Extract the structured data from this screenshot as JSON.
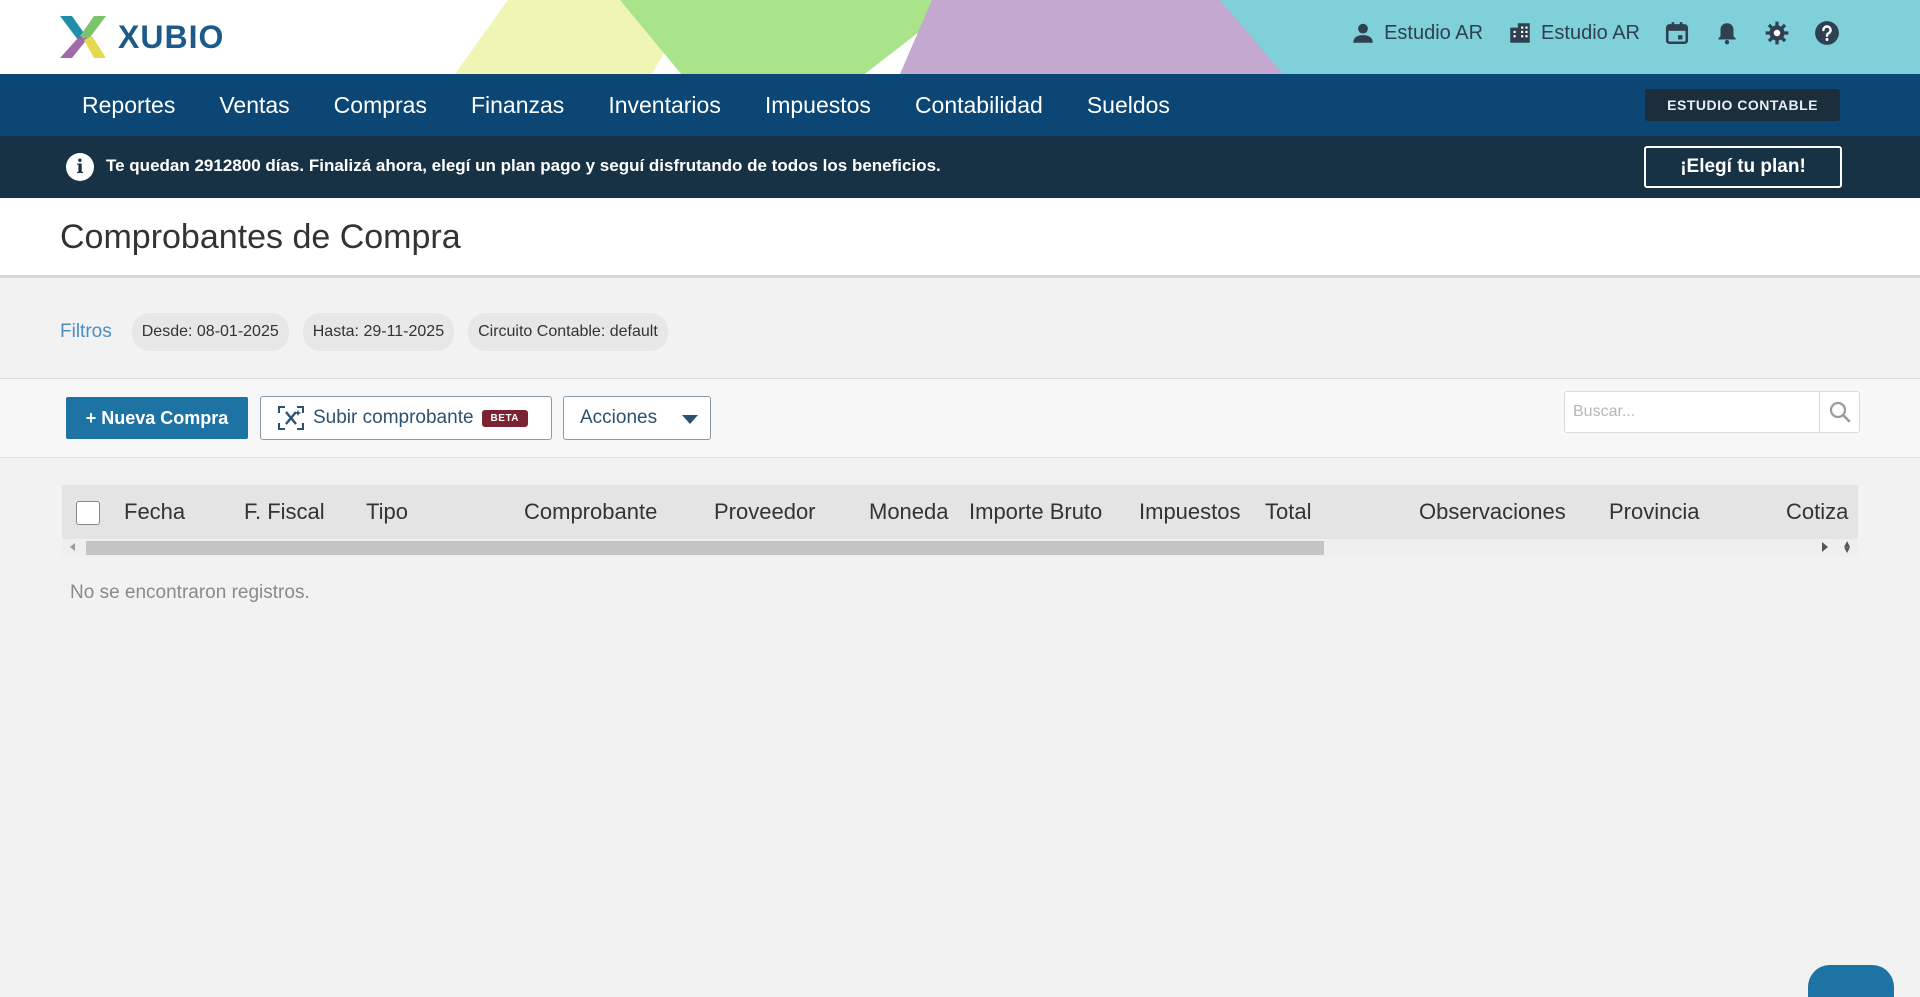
{
  "brand": {
    "name": "XUBIO"
  },
  "topbar": {
    "user_label": "Estudio AR",
    "company_label": "Estudio AR",
    "icons": [
      "user-icon",
      "building-icon",
      "calendar-icon",
      "bell-icon",
      "gear-icon",
      "help-icon"
    ]
  },
  "nav": {
    "items": [
      "Reportes",
      "Ventas",
      "Compras",
      "Finanzas",
      "Inventarios",
      "Impuestos",
      "Contabilidad",
      "Sueldos"
    ],
    "badge": "ESTUDIO CONTABLE"
  },
  "trial": {
    "message": "Te quedan 2912800 días. Finalizá ahora, elegí un plan pago y seguí disfrutando de todos los beneficios.",
    "button": "¡Elegí tu plan!"
  },
  "page": {
    "title": "Comprobantes de Compra"
  },
  "filters": {
    "label": "Filtros",
    "chips": [
      {
        "key": "Desde:",
        "value": "08-01-2025"
      },
      {
        "key": "Hasta:",
        "value": "29-11-2025"
      },
      {
        "key": "Circuito Contable:",
        "value": "default"
      }
    ]
  },
  "toolbar": {
    "new_button": "+ Nueva Compra",
    "upload_button": "Subir comprobante",
    "beta_badge": "BETA",
    "actions_button": "Acciones",
    "search_placeholder": "Buscar..."
  },
  "table": {
    "columns": [
      "Fecha",
      "F. Fiscal",
      "Tipo",
      "Comprobante",
      "Proveedor",
      "Moneda",
      "Importe Bruto",
      "Impuestos",
      "Total",
      "Observaciones",
      "Provincia",
      "Cotiza"
    ],
    "empty_message": "No se encontraron registros."
  },
  "colors": {
    "nav_bg": "#0b4674",
    "trial_bg": "#173245",
    "primary_button": "#1e73a5",
    "beta_badge": "#7b2233",
    "filters_label": "#4c8ec2"
  }
}
